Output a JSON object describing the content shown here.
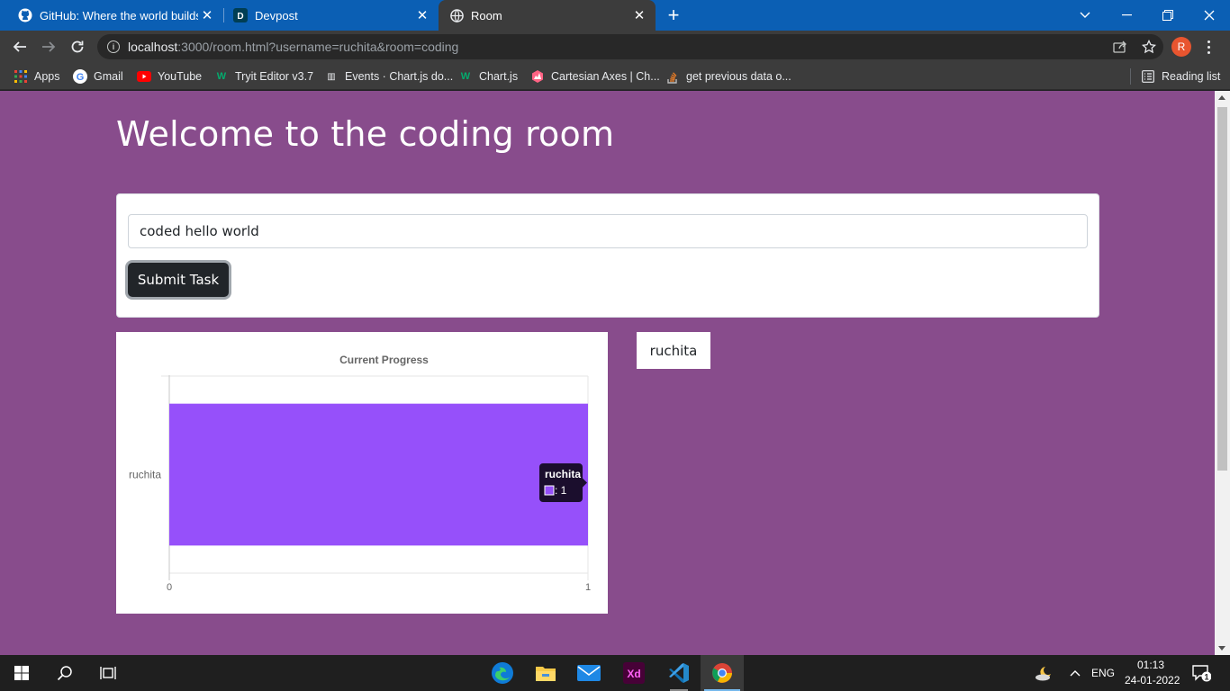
{
  "browser": {
    "tabs": [
      {
        "title": "GitHub: Where the world builds s",
        "icon": "github-icon"
      },
      {
        "title": "Devpost",
        "icon": "devpost-icon"
      },
      {
        "title": "Room",
        "icon": "globe-icon"
      }
    ],
    "url_host": "localhost",
    "url_rest": ":3000/room.html?username=ruchita&room=coding",
    "profile_initial": "R",
    "bookmarks": [
      {
        "label": "Apps"
      },
      {
        "label": "Gmail"
      },
      {
        "label": "YouTube"
      },
      {
        "label": "Tryit Editor v3.7"
      },
      {
        "label": "Events · Chart.js do..."
      },
      {
        "label": "Chart.js"
      },
      {
        "label": "Cartesian Axes | Ch..."
      },
      {
        "label": "get previous data o..."
      }
    ],
    "reading_list": "Reading list"
  },
  "page": {
    "title": "Welcome to the coding room",
    "task_input_value": "coded hello world",
    "submit_label": "Submit Task",
    "user_chip": "ruchita"
  },
  "chart_data": {
    "type": "bar",
    "orientation": "horizontal",
    "title": "Current Progress",
    "categories": [
      "ruchita"
    ],
    "series": [
      {
        "values": [
          1
        ]
      }
    ],
    "xlim": [
      0,
      1
    ],
    "x_ticks": [
      "0",
      "1"
    ],
    "bar_color": "#9650fa",
    "grid": true,
    "tooltip": {
      "title": "ruchita",
      "value_text": ": 1"
    }
  },
  "taskbar": {
    "language": "ENG",
    "time": "01:13",
    "date": "24-01-2022",
    "notifications": "1"
  },
  "colors": {
    "page_background": "#884c8c",
    "tab_strip": "#0b5fb4",
    "chrome_toolbar": "#3c3c3c"
  }
}
